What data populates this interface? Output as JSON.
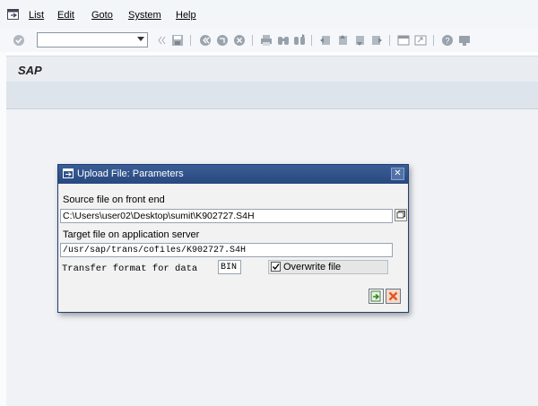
{
  "menu": {
    "items": [
      {
        "label": "List"
      },
      {
        "label": "Edit"
      },
      {
        "label": "Goto"
      },
      {
        "label": "System"
      },
      {
        "label": "Help"
      }
    ]
  },
  "toolbar": {
    "command_field_value": ""
  },
  "title": {
    "text": "SAP"
  },
  "dialog": {
    "title": "Upload File: Parameters",
    "source_label": "Source file on front end",
    "source_value": "C:\\Users\\user02\\Desktop\\sumit\\K902727.S4H",
    "target_label": "Target file on application server",
    "target_value": "/usr/sap/trans/cofiles/K902727.S4H",
    "format_label": "Transfer format for data",
    "format_value": "BIN",
    "overwrite_label": "Overwrite file",
    "overwrite_checked": true
  },
  "colors": {
    "dialog_title_bg": "#27497f",
    "confirm_green": "#2e8b2e",
    "cancel_orange": "#e2571b"
  }
}
